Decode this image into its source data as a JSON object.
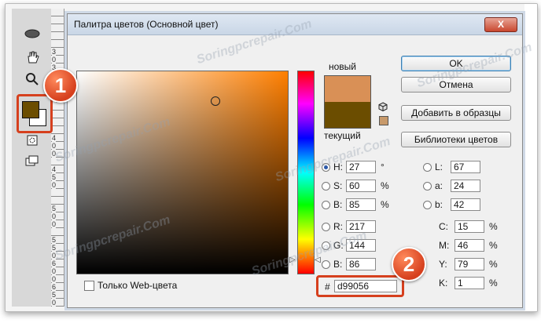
{
  "dialog": {
    "title": "Палитра цветов (Основной цвет)",
    "close_label": "X"
  },
  "labels": {
    "new": "новый",
    "current": "текущий"
  },
  "buttons": {
    "ok": "OK",
    "cancel": "Отмена",
    "add_to_swatches": "Добавить в образцы",
    "color_libraries": "Библиотеки цветов"
  },
  "fields": {
    "h": {
      "label": "H:",
      "value": "27",
      "unit": "°"
    },
    "s": {
      "label": "S:",
      "value": "60",
      "unit": "%"
    },
    "b": {
      "label": "B:",
      "value": "85",
      "unit": "%"
    },
    "r": {
      "label": "R:",
      "value": "217"
    },
    "g": {
      "label": "G:",
      "value": "144"
    },
    "bb": {
      "label": "B:",
      "value": "86"
    },
    "l": {
      "label": "L:",
      "value": "67"
    },
    "a": {
      "label": "a:",
      "value": "24"
    },
    "b2": {
      "label": "b:",
      "value": "42"
    },
    "c": {
      "label": "C:",
      "value": "15",
      "unit": "%"
    },
    "m": {
      "label": "M:",
      "value": "46",
      "unit": "%"
    },
    "y": {
      "label": "Y:",
      "value": "79",
      "unit": "%"
    },
    "k": {
      "label": "K:",
      "value": "1",
      "unit": "%"
    }
  },
  "web_only_label": "Только Web-цвета",
  "hex": {
    "hash": "#",
    "value": "d99056"
  },
  "badges": {
    "one": "1",
    "two": "2"
  },
  "ruler": [
    "3",
    "0",
    "3",
    "5",
    "0",
    "4",
    "0",
    "0",
    "4",
    "5",
    "0",
    "5",
    "0",
    "0",
    "5",
    "5",
    "0",
    "6",
    "0",
    "0",
    "6",
    "5",
    "0"
  ],
  "watermark": "Soringpcrepair.Com",
  "colors": {
    "new_swatch": "#d99056",
    "current_swatch": "#6b4d00",
    "accent": "#d6401e",
    "foreground_tool": "#6b4d00"
  }
}
